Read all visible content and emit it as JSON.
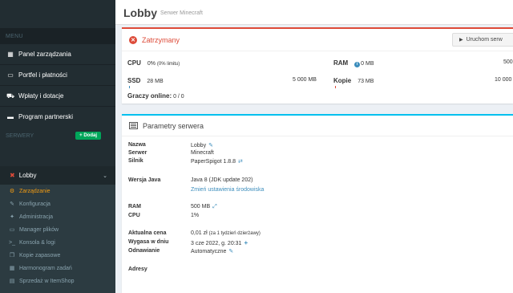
{
  "header": {
    "title": "Lobby",
    "subtitle": "Serwer Minecraft"
  },
  "sidebar": {
    "menu_header": "MENU",
    "items": [
      {
        "label": "Panel zarządzania",
        "icon": "dashboard-icon"
      },
      {
        "label": "Portfel i płatności",
        "icon": "wallet-icon"
      },
      {
        "label": "Wpłaty i dotacje",
        "icon": "cart-icon"
      },
      {
        "label": "Program partnerski",
        "icon": "briefcase-icon"
      }
    ],
    "servers_label": "SERWERY",
    "add_label": "+ Dodaj",
    "server_name": "Lobby",
    "sub_items": [
      {
        "label": "Zarządzanie",
        "icon": "gears-icon",
        "active": true
      },
      {
        "label": "Konfiguracja",
        "icon": "wrench-icon",
        "active": false
      },
      {
        "label": "Administracja",
        "icon": "star-icon",
        "active": false
      },
      {
        "label": "Manager plików",
        "icon": "folder-icon",
        "active": false
      },
      {
        "label": "Konsola & logi",
        "icon": "terminal-icon",
        "active": false
      },
      {
        "label": "Kopie zapasowe",
        "icon": "copy-icon",
        "active": false
      },
      {
        "label": "Harmonogram zadań",
        "icon": "calendar-icon",
        "active": false
      },
      {
        "label": "Sprzedaż w ItemShop",
        "icon": "shop-icon",
        "active": false
      }
    ]
  },
  "status": {
    "state": "Zatrzymany",
    "start_label": "Uruchom serw",
    "cpu_label": "CPU",
    "cpu_value": "0%",
    "cpu_limit": "(0% limitu)",
    "ram_label": "RAM",
    "ram_value": "0 MB",
    "ram_max": "500",
    "ssd_label": "SSD",
    "ssd_value": "28 MB",
    "ssd_max": "5 000 MB",
    "backups_label": "Kopie",
    "backups_value": "73 MB",
    "backups_max": "10 000",
    "players_label": "Graczy online:",
    "players_value": "0 / 0"
  },
  "params": {
    "title": "Parametry serwera",
    "rows": {
      "name_label": "Nazwa",
      "name_value": "Lobby",
      "server_label": "Serwer",
      "server_value": "Minecraft",
      "engine_label": "Silnik",
      "engine_value": "PaperSpigot 1.8.8",
      "java_label": "Wersja Java",
      "java_value": "Java 8 (JDK update 202)",
      "java_link": "Zmień ustawienia środowiska",
      "ram_label": "RAM",
      "ram_value": "500 MB",
      "cpu_label": "CPU",
      "cpu_value": "1%",
      "price_label": "Aktualna cena",
      "price_value": "0,01 zł",
      "price_note": "(za 1 tydzień dzierżawy)",
      "expires_label": "Wygasa w dniu",
      "expires_value": "3 cze 2022, g. 20:31",
      "renewal_label": "Odnawianie",
      "renewal_value": "Automatyczne",
      "addresses_label": "Adresy"
    }
  },
  "colors": {
    "danger": "#dd4b39",
    "accent": "#3c8dbc",
    "success": "#00a65a",
    "info": "#00c0ef",
    "active_sub": "#f39c12"
  }
}
